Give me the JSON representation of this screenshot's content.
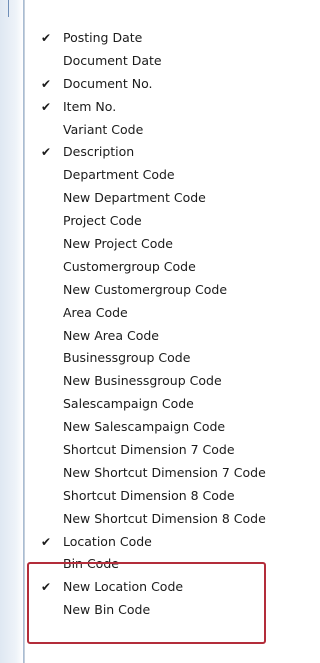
{
  "column_menu": {
    "items": [
      {
        "label": "Posting Date",
        "checked": true
      },
      {
        "label": "Document Date",
        "checked": false
      },
      {
        "label": "Document No.",
        "checked": true
      },
      {
        "label": "Item No.",
        "checked": true
      },
      {
        "label": "Variant Code",
        "checked": false
      },
      {
        "label": "Description",
        "checked": true
      },
      {
        "label": "Department Code",
        "checked": false
      },
      {
        "label": "New Department Code",
        "checked": false
      },
      {
        "label": "Project Code",
        "checked": false
      },
      {
        "label": "New Project Code",
        "checked": false
      },
      {
        "label": "Customergroup Code",
        "checked": false
      },
      {
        "label": "New Customergroup Code",
        "checked": false
      },
      {
        "label": "Area Code",
        "checked": false
      },
      {
        "label": "New Area Code",
        "checked": false
      },
      {
        "label": "Businessgroup Code",
        "checked": false
      },
      {
        "label": "New Businessgroup Code",
        "checked": false
      },
      {
        "label": "Salescampaign Code",
        "checked": false
      },
      {
        "label": "New Salescampaign Code",
        "checked": false
      },
      {
        "label": "Shortcut Dimension 7 Code",
        "checked": false
      },
      {
        "label": "New Shortcut Dimension 7 Code",
        "checked": false
      },
      {
        "label": "Shortcut Dimension 8 Code",
        "checked": false
      },
      {
        "label": "New Shortcut Dimension 8 Code",
        "checked": false
      },
      {
        "label": "Location Code",
        "checked": true
      },
      {
        "label": "Bin Code",
        "checked": false
      },
      {
        "label": "New Location Code",
        "checked": true
      },
      {
        "label": "New Bin Code",
        "checked": false
      }
    ],
    "check_glyph": "✔"
  },
  "annotation": {
    "color": "#b32d3a"
  }
}
